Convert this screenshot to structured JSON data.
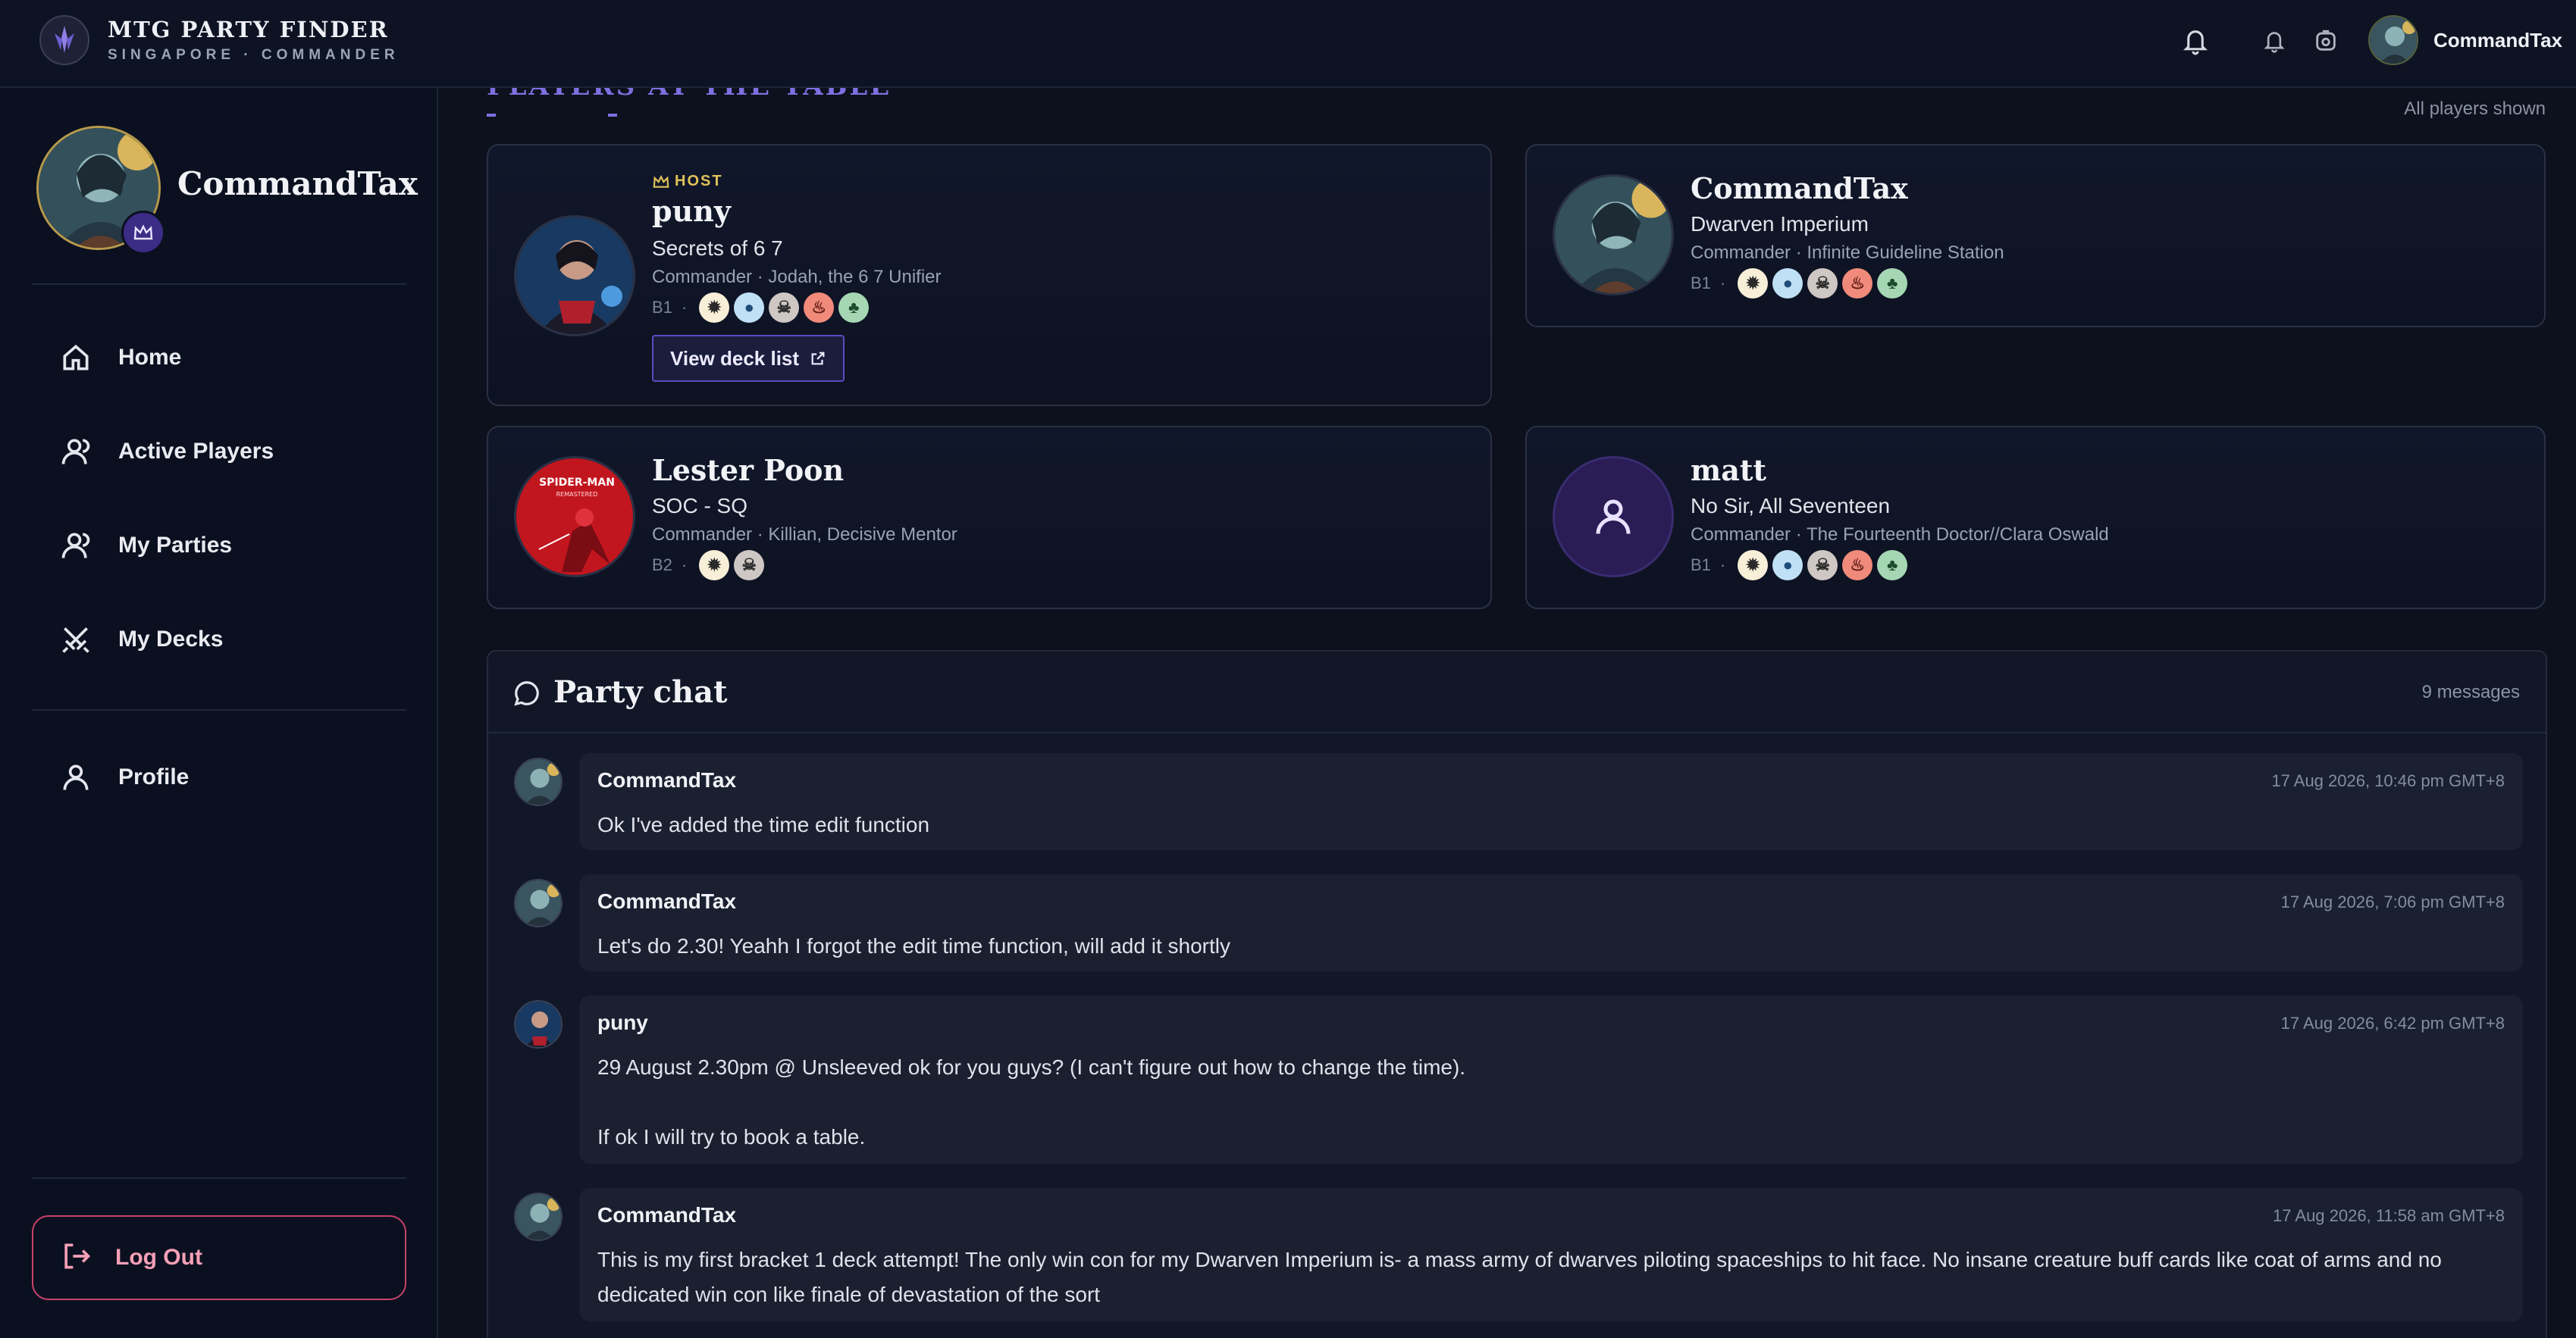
{
  "brand": {
    "title": "MTG PARTY FINDER",
    "subtitle": "SINGAPORE · COMMANDER"
  },
  "topbar": {
    "username": "CommandTax",
    "icons": [
      "bell-icon",
      "notification-bell-icon",
      "refresh-icon"
    ]
  },
  "sidebar": {
    "username": "CommandTax",
    "items": [
      {
        "label": "Home",
        "icon": "home-icon"
      },
      {
        "label": "Active Players",
        "icon": "user-icon"
      },
      {
        "label": "My Parties",
        "icon": "user-icon"
      },
      {
        "label": "My Decks",
        "icon": "crossed-swords-icon"
      },
      {
        "label": "Profile",
        "icon": "user-icon"
      }
    ],
    "logout_label": "Log Out"
  },
  "section": {
    "title": "PLAYERS AT THE TABLE",
    "note": "All players shown"
  },
  "players": [
    {
      "host_label": "HOST",
      "name": "puny",
      "deck": "Secrets of 6 7",
      "sub": "Commander · Jodah, the 6 7 Unifier",
      "bracket": "B1",
      "mana": [
        "W",
        "U",
        "B",
        "R",
        "G"
      ],
      "button": "View deck list"
    },
    {
      "name": "CommandTax",
      "deck": "Dwarven Imperium",
      "sub": "Commander · Infinite Guideline Station",
      "bracket": "B1",
      "mana": [
        "W",
        "U",
        "B",
        "R",
        "G"
      ]
    },
    {
      "name": "Lester Poon",
      "deck": "SOC - SQ",
      "sub": "Commander · Killian, Decisive Mentor",
      "bracket": "B2",
      "mana": [
        "W",
        "B"
      ],
      "avatar_text": "SPIDER-MAN REMASTERED"
    },
    {
      "name": "matt",
      "deck": "No Sir, All Seventeen",
      "sub": "Commander · The Fourteenth Doctor//Clara Oswald",
      "bracket": "B1",
      "mana": [
        "W",
        "U",
        "B",
        "R",
        "G"
      ]
    }
  ],
  "chat": {
    "title": "Party chat",
    "count": "9 messages",
    "messages": [
      {
        "author": "CommandTax",
        "time": "17 Aug 2026, 10:46 pm GMT+8",
        "text": "Ok I've added the time edit function"
      },
      {
        "author": "CommandTax",
        "time": "17 Aug 2026, 7:06 pm GMT+8",
        "text": "Let's do 2.30! Yeahh I forgot the edit time function, will add it shortly"
      },
      {
        "author": "puny",
        "time": "17 Aug 2026, 6:42 pm GMT+8",
        "text": "29 August 2.30pm @ Unsleeved ok for you guys? (I can't figure out how to change the time).\n\nIf ok I will try to book a table."
      },
      {
        "author": "CommandTax",
        "time": "17 Aug 2026, 11:58 am GMT+8",
        "text": "This is my first bracket 1 deck attempt! The only win con for my Dwarven Imperium is- a mass army of dwarves piloting spaceships to hit face. No insane creature buff cards like coat of arms and no dedicated win con like finale of devastation of the sort"
      }
    ]
  },
  "colors": {
    "accent": "#7f6fe0",
    "host": "#e0c25a",
    "logout": "#c8426b",
    "bg": "#0c111d"
  }
}
